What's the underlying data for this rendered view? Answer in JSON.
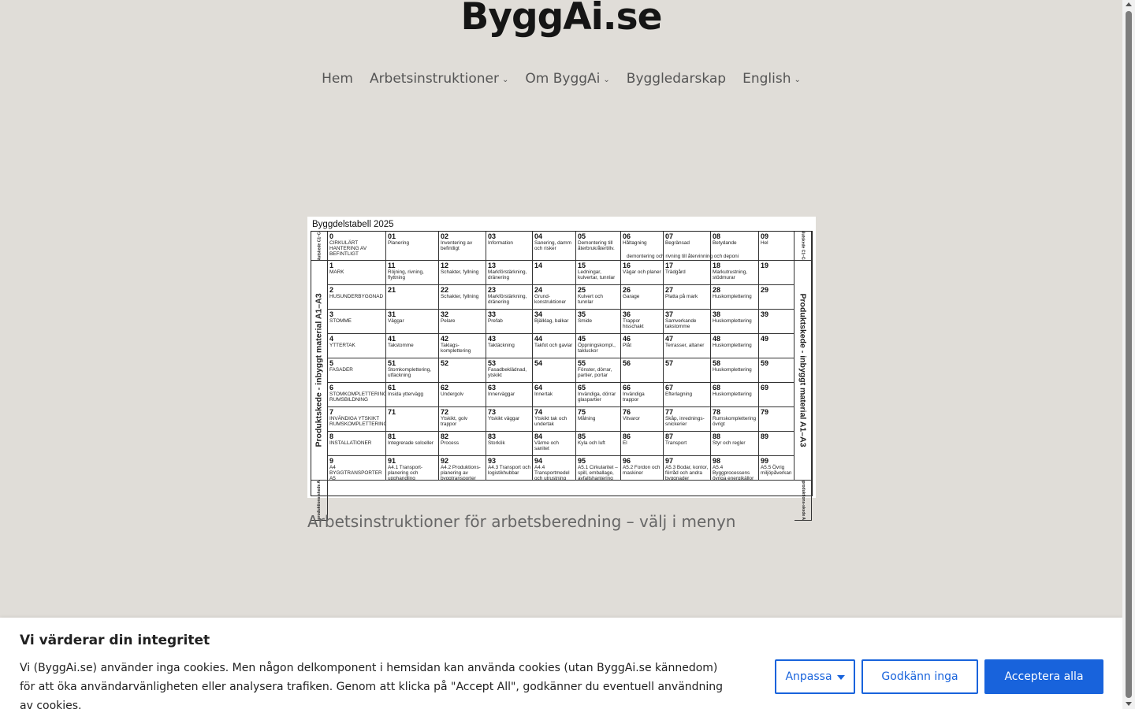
{
  "site": {
    "title": "ByggAi.se"
  },
  "nav": {
    "items": [
      {
        "label": "Hem",
        "dropdown": false
      },
      {
        "label": "Arbetsinstruktioner",
        "dropdown": true
      },
      {
        "label": "Om ByggAi",
        "dropdown": true
      },
      {
        "label": "Byggledarskap",
        "dropdown": false
      },
      {
        "label": "English",
        "dropdown": true
      }
    ]
  },
  "table": {
    "title": "Byggdelstabell 2025",
    "side_left_top": "Slutskede C1–C4",
    "side_right_top": "Slutskede C1–C4",
    "side_left_main": "Produktskede - inbyggt material  A1–A3",
    "side_right_main": "Produktskede - inbyggt material  A1–A3",
    "side_left_bottom": "Byggproduktions-skede A4–A5",
    "side_right_bottom": "Byggproduktions-skede A4–A5",
    "row0_note": "demontering och rivning till återvinning och deponi",
    "rows": [
      [
        [
          "0",
          "CIRKULÄRT HANTERING AV BEFINTLIGT"
        ],
        [
          "01",
          "Planering"
        ],
        [
          "02",
          "Inventering av befintligt"
        ],
        [
          "03",
          "Information"
        ],
        [
          "04",
          "Sanering, damm och risker"
        ],
        [
          "05",
          "Demontering till återbruk/återtillv."
        ],
        [
          "06",
          "Håltagning"
        ],
        [
          "07",
          "Begränsad"
        ],
        [
          "08",
          "Betydande"
        ],
        [
          "09",
          "Hel"
        ]
      ],
      [
        [
          "1",
          "MARK"
        ],
        [
          "11",
          "Röjning, rivning, flyttning"
        ],
        [
          "12",
          "Schakter, fyllning"
        ],
        [
          "13",
          "Markförstärkning, dränering"
        ],
        [
          "14",
          ""
        ],
        [
          "15",
          "Ledningar, kulvertar, tunnlar"
        ],
        [
          "16",
          "Vägar och planer"
        ],
        [
          "17",
          "Trädgård"
        ],
        [
          "18",
          "Markutrustning, stödmurar"
        ],
        [
          "19",
          ""
        ]
      ],
      [
        [
          "2",
          "HUSUNDERBYGGNAD"
        ],
        [
          "21",
          ""
        ],
        [
          "22",
          "Schakter, fyllning"
        ],
        [
          "23",
          "Markförstärkning, dränering"
        ],
        [
          "24",
          "Grund-konstruktioner"
        ],
        [
          "25",
          "Kulvert och tunnlar"
        ],
        [
          "26",
          "Garage"
        ],
        [
          "27",
          "Platta på mark"
        ],
        [
          "28",
          "Huskomplettering"
        ],
        [
          "29",
          ""
        ]
      ],
      [
        [
          "3",
          "STOMME"
        ],
        [
          "31",
          "Väggar"
        ],
        [
          "32",
          "Pelare"
        ],
        [
          "33",
          "Prefab"
        ],
        [
          "34",
          "Bjälklag, balkar"
        ],
        [
          "35",
          "Smide"
        ],
        [
          "36",
          "Trappor hisschakt"
        ],
        [
          "37",
          "Samverkande takstomme"
        ],
        [
          "38",
          "Huskomplettering"
        ],
        [
          "39",
          ""
        ]
      ],
      [
        [
          "4",
          "YTTERTAK"
        ],
        [
          "41",
          "Takstomme"
        ],
        [
          "42",
          "Taklags-komplettering"
        ],
        [
          "43",
          "Taktäckning"
        ],
        [
          "44",
          "Takfot och gavlar"
        ],
        [
          "45",
          "Öppningskompl., takluckor"
        ],
        [
          "46",
          "Plåt"
        ],
        [
          "47",
          "Terrasser, altaner"
        ],
        [
          "48",
          "Huskomplettering"
        ],
        [
          "49",
          ""
        ]
      ],
      [
        [
          "5",
          "FASADER"
        ],
        [
          "51",
          "Stomkomplettering, utfackning"
        ],
        [
          "52",
          ""
        ],
        [
          "53",
          "Fasadbeklädnad, ytskikt"
        ],
        [
          "54",
          ""
        ],
        [
          "55",
          "Fönster, dörrar, partier, portar"
        ],
        [
          "56",
          ""
        ],
        [
          "57",
          ""
        ],
        [
          "58",
          "Huskomplettering"
        ],
        [
          "59",
          ""
        ]
      ],
      [
        [
          "6",
          "STOMKOMPLETTERING RUMSBILDNING"
        ],
        [
          "61",
          "Insida yttervägg"
        ],
        [
          "62",
          "Undergolv"
        ],
        [
          "63",
          "Innerväggar"
        ],
        [
          "64",
          "Innertak"
        ],
        [
          "65",
          "Invändiga, dörrar glaspartier"
        ],
        [
          "66",
          "Invändiga trappor"
        ],
        [
          "67",
          "Efterlagning"
        ],
        [
          "68",
          "Huskomplettering"
        ],
        [
          "69",
          ""
        ]
      ],
      [
        [
          "7",
          "INVÄNDIGA YTSKIKT RUMSKOMPLETTERING"
        ],
        [
          "71",
          ""
        ],
        [
          "72",
          "Ytskikt, golv trappor"
        ],
        [
          "73",
          "Ytskikt väggar"
        ],
        [
          "74",
          "Ytskikt tak och undertak"
        ],
        [
          "75",
          "Målning"
        ],
        [
          "76",
          "Vitvaror"
        ],
        [
          "77",
          "Skåp, inrednings-snickerier"
        ],
        [
          "78",
          "Rumskomplettering övrigt"
        ],
        [
          "79",
          ""
        ]
      ],
      [
        [
          "8",
          "INSTALLATIONER"
        ],
        [
          "81",
          "Integrerade solceller"
        ],
        [
          "82",
          "Process"
        ],
        [
          "83",
          "Storkök"
        ],
        [
          "84",
          "Värme och sanitet"
        ],
        [
          "85",
          "Kyla och luft"
        ],
        [
          "86",
          "El"
        ],
        [
          "87",
          "Transport"
        ],
        [
          "88",
          "Styr och regler"
        ],
        [
          "89",
          ""
        ]
      ],
      [
        [
          "9",
          "A4 BYGGTRANSPORTER A5 BYGGARBETSPLATS"
        ],
        [
          "91",
          "A4.1 Transport-planering och upphandling"
        ],
        [
          "92",
          "A4.2 Produktions-planering av byggtransporter"
        ],
        [
          "93",
          "A4.3 Transport och logistikhubbar"
        ],
        [
          "94",
          "A4.4 Transportmedel och utrustning"
        ],
        [
          "95",
          "A5.1 Cirkularitet – spill, emballage, avfallshantering"
        ],
        [
          "96",
          "A5.2 Fordon och maskiner"
        ],
        [
          "97",
          "A5.3 Bodar, kontor, förråd och andra byggnader"
        ],
        [
          "98",
          "A5.4 Byggprocessens övriga energikällor"
        ],
        [
          "99",
          "A5.5 Övrig miljöpåverkan"
        ]
      ]
    ]
  },
  "caption": "Arbetsinstruktioner för arbetsberedning – välj i menyn",
  "cookie": {
    "title": "Vi värderar din integritet",
    "text": "Vi (ByggAi.se) använder inga cookies. Men någon delkomponent i hemsidan kan använda cookies (utan ByggAi.se kännedom) för att öka användarvänligheten eller analysera trafiken. Genom att klicka på \"Accept All\", godkänner du eventuell användning av cookies.",
    "customize_label": "Anpassa",
    "reject_label": "Godkänn inga",
    "accept_label": "Acceptera alla",
    "accent_color": "#1863dc"
  }
}
